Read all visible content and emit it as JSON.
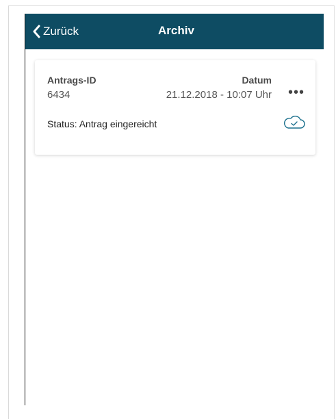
{
  "navbar": {
    "back_label": "Zurück",
    "title": "Archiv",
    "background": "#0e4c63"
  },
  "card": {
    "id_label": "Antrags-ID",
    "id_value": "6434",
    "date_label": "Datum",
    "date_value": "21.12.2018 - 10:07 Uhr",
    "more_icon": "more-dots-icon",
    "status_text": "Status: Antrag eingereicht",
    "status_icon": "cloud-check-icon",
    "accent": "#1a6f8c"
  }
}
